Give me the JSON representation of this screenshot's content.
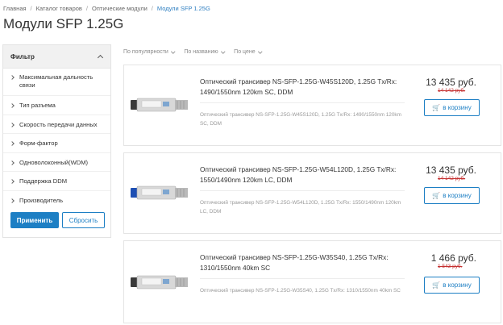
{
  "breadcrumb": {
    "items": [
      "Главная",
      "Каталог товаров",
      "Оптические модули"
    ],
    "current": "Модули SFP 1.25G",
    "separator": "/"
  },
  "page_title": "Модули SFP 1.25G",
  "filter": {
    "title": "Фильтр",
    "items": [
      "Максимальная дальность связи",
      "Тип разъема",
      "Скорость передачи данных",
      "Форм-фактор",
      "Одноволоконный(WDM)",
      "Поддержка DDM",
      "Производитель"
    ],
    "apply_label": "Применить",
    "reset_label": "Сбросить"
  },
  "sort": {
    "options": [
      "По популярности",
      "По названию",
      "По цене"
    ]
  },
  "products": [
    {
      "title": "Оптический трансивер NS-SFP-1.25G-W45S120D, 1.25G Tx/Rx: 1490/1550nm 120km SC, DDM",
      "description": "Оптический трансивер NS-SFP-1.25G-W45S120D, 1.25G Tx/Rx: 1490/1550nm 120km SC, DDM",
      "price": "13 435 руб.",
      "old_price": "14 142 руб.",
      "cart_label": "в корзину",
      "connector_color": "#3a3a3a"
    },
    {
      "title": "Оптический трансивер NS-SFP-1.25G-W54L120D, 1.25G Tx/Rx: 1550/1490nm 120km LC, DDM",
      "description": "Оптический трансивер NS-SFP-1.25G-W54L120D, 1.25G Tx/Rx: 1550/1490nm 120km LC, DDM",
      "price": "13 435 руб.",
      "old_price": "14 142 руб.",
      "cart_label": "в корзину",
      "connector_color": "#1e4fb3"
    },
    {
      "title": "Оптический трансивер NS-SFP-1.25G-W35S40, 1.25G Tx/Rx: 1310/1550nm 40km SC",
      "description": "Оптический трансивер NS-SFP-1.25G-W35S40, 1.25G Tx/Rx: 1310/1550nm 40km SC",
      "price": "1 466 руб.",
      "old_price": "1 543 руб.",
      "cart_label": "в корзину",
      "connector_color": "#3a3a3a"
    }
  ],
  "colors": {
    "accent": "#1d7fc4",
    "old_price": "#c53030",
    "breadcrumb_current": "#2f7fc1"
  },
  "icons": {
    "filter_toggle": "chevron-up-icon",
    "filter_item": "chevron-right-icon",
    "sort": "chevron-down-icon",
    "cart": "cart-icon"
  }
}
